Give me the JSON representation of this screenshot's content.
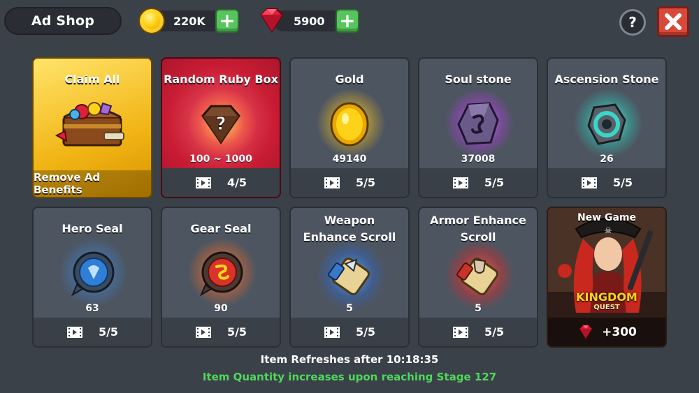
{
  "header": {
    "title": "Ad Shop",
    "gold": "220K",
    "ruby": "5900",
    "help_label": "?"
  },
  "cards": [
    {
      "name": "Claim All",
      "footer_text": "Remove Ad Benefits",
      "icon": "treasure-chest-icon"
    },
    {
      "name": "Random Ruby Box",
      "quantity": "100 ~ 1000",
      "count": "4/5",
      "icon": "ruby-box-icon"
    },
    {
      "name": "Gold",
      "quantity": "49140",
      "count": "5/5",
      "icon": "gold-coin-icon"
    },
    {
      "name": "Soul stone",
      "quantity": "37008",
      "count": "5/5",
      "icon": "soul-stone-icon"
    },
    {
      "name": "Ascension Stone",
      "quantity": "26",
      "count": "5/5",
      "icon": "ascension-stone-icon"
    },
    {
      "name": "Hero Seal",
      "quantity": "63",
      "count": "5/5",
      "icon": "hero-seal-icon"
    },
    {
      "name": "Gear Seal",
      "quantity": "90",
      "count": "5/5",
      "icon": "gear-seal-icon"
    },
    {
      "name": "Weapon Enhance Scroll",
      "quantity": "5",
      "count": "5/5",
      "icon": "weapon-scroll-icon"
    },
    {
      "name": "Armor Enhance Scroll",
      "quantity": "5",
      "count": "5/5",
      "icon": "armor-scroll-icon"
    },
    {
      "name": "New Game",
      "game_logo_line1": "KINGDOM",
      "game_logo_line2": "QUEST",
      "reward": "+300",
      "icon": "pirate-heroine-art"
    }
  ],
  "footer": {
    "refresh": "Item Refreshes after 10:18:35",
    "note": "Item Quantity increases upon reaching Stage 127"
  },
  "colors": {
    "background": "#3b4149",
    "note_green": "#4fd85a",
    "close_red": "#d8493a",
    "plus_green": "#58c45e"
  }
}
